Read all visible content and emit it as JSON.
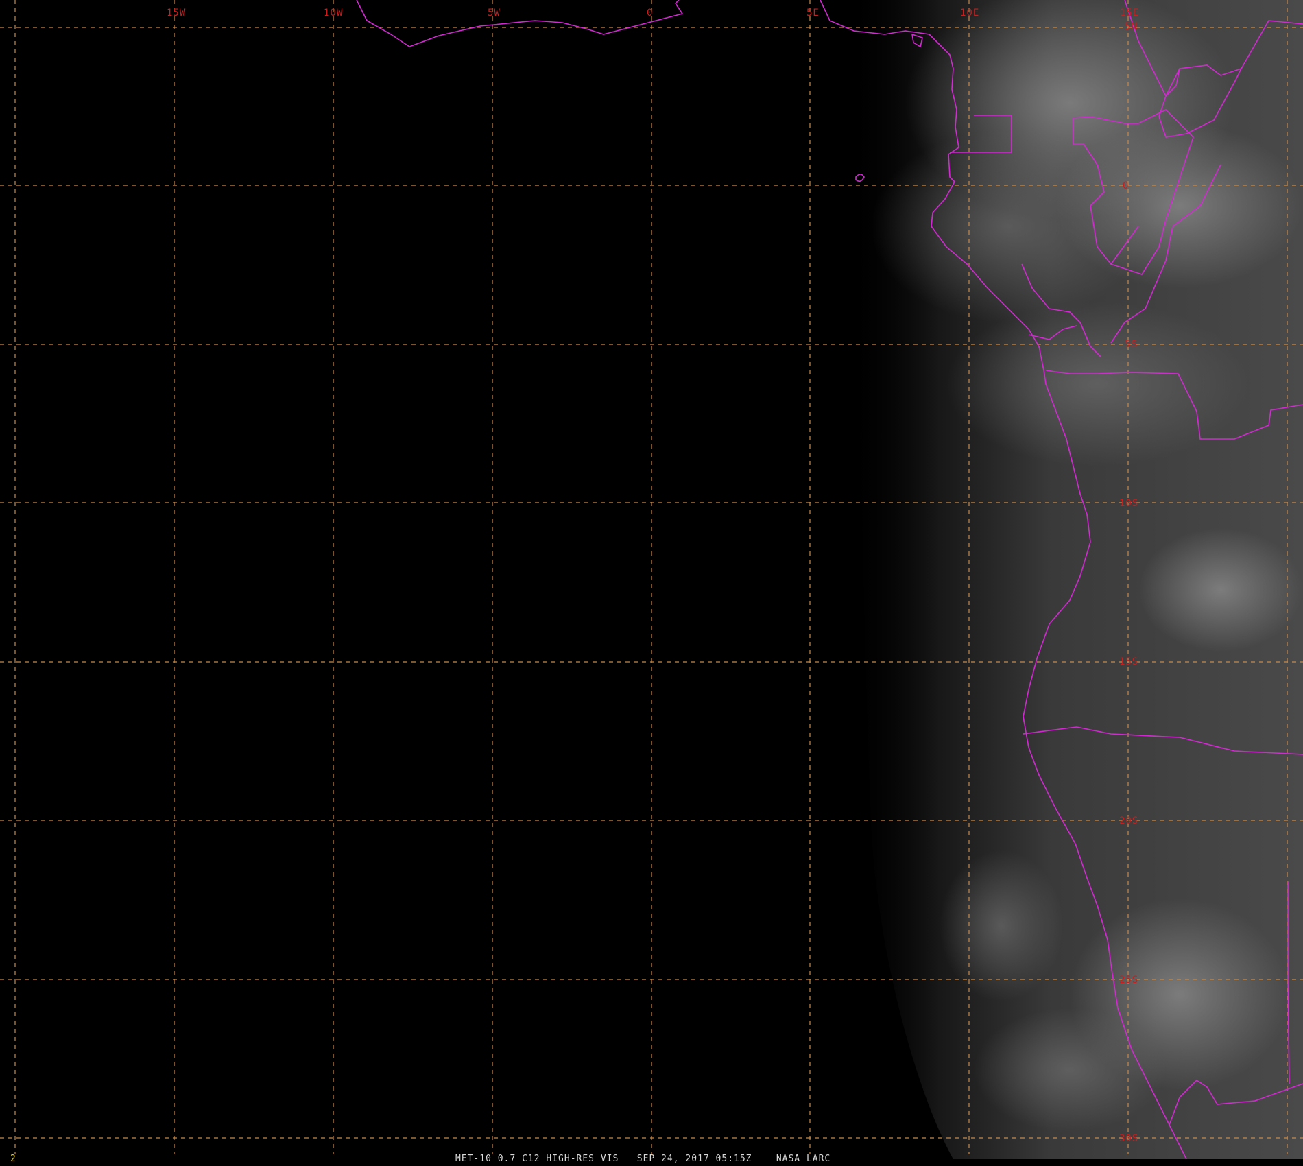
{
  "map": {
    "longitude_labels": [
      "15W",
      "10W",
      "5W",
      "0",
      "5E",
      "10E",
      "15E"
    ],
    "latitude_labels": [
      "5N",
      "0",
      "5S",
      "10S",
      "15S",
      "20S",
      "25S",
      "30S"
    ],
    "colors": {
      "background": "#000000",
      "graticule": "#c98a4a",
      "grid_label": "#c81e1e",
      "boundaries": "#d22ad2",
      "caption_text": "#d8d8d8",
      "frame_number": "#e6d21e"
    }
  },
  "footer": {
    "frame_number": "2",
    "caption": "MET-10 0.7 C12 HIGH-RES VIS   SEP 24, 2017 05:15Z    NASA LARC"
  }
}
